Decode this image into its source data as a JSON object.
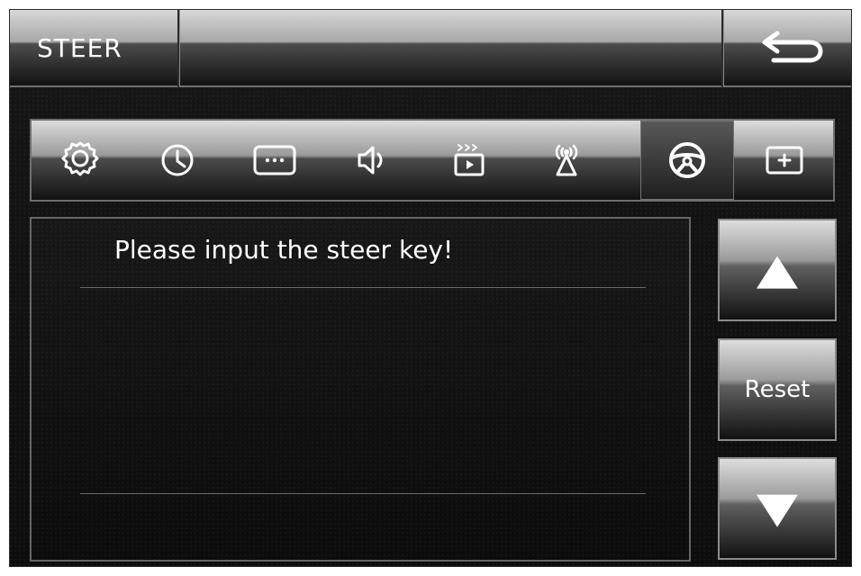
{
  "header": {
    "title": "STEER",
    "back_icon": "return-arrow-icon"
  },
  "tabs": [
    {
      "icon": "gear-icon",
      "active": false
    },
    {
      "icon": "clock-icon",
      "active": false
    },
    {
      "icon": "ellipsis-box-icon",
      "active": false
    },
    {
      "icon": "speaker-icon",
      "active": false
    },
    {
      "icon": "video-play-icon",
      "active": false
    },
    {
      "icon": "antenna-icon",
      "active": false
    },
    {
      "icon": "steering-wheel-icon",
      "active": true
    },
    {
      "icon": "plus-box-icon",
      "active": false
    }
  ],
  "main": {
    "message": "Please input the steer key!"
  },
  "controls": {
    "up_icon": "up-triangle-icon",
    "reset_label": "Reset",
    "down_icon": "down-triangle-icon"
  },
  "colors": {
    "text": "#ffffff",
    "accent": "#d8d8d8"
  }
}
